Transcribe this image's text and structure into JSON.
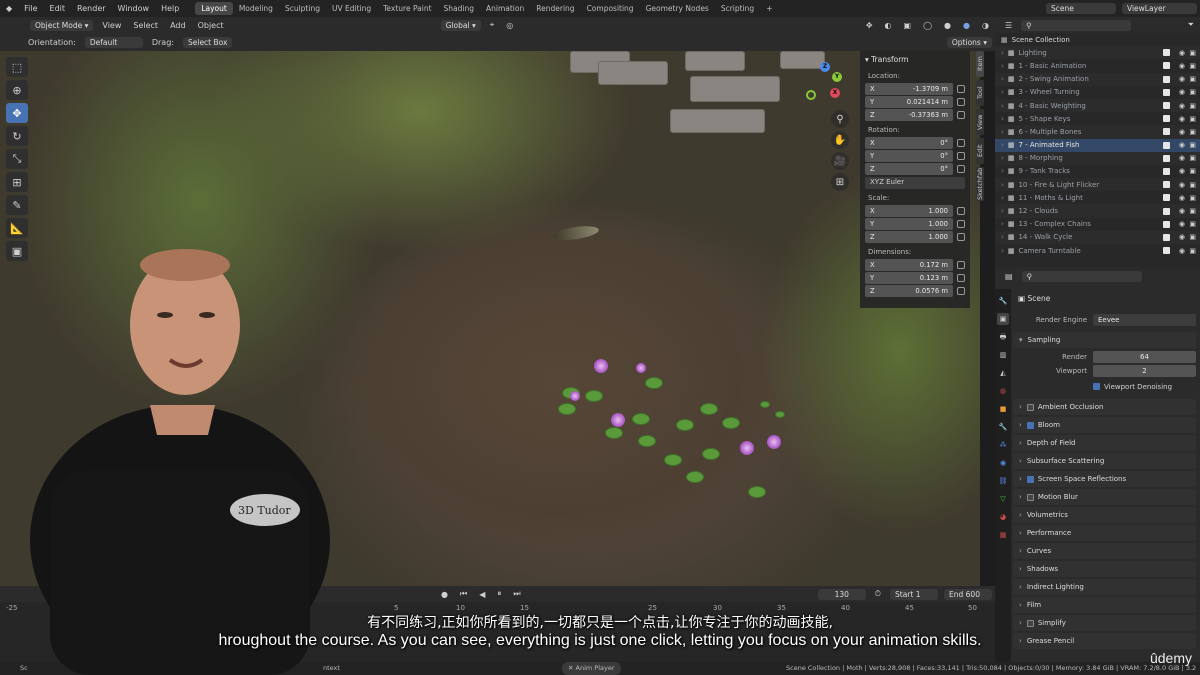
{
  "topbar": {
    "menus": [
      "File",
      "Edit",
      "Render",
      "Window",
      "Help"
    ],
    "workspaces": [
      "Layout",
      "Modeling",
      "Sculpting",
      "UV Editing",
      "Texture Paint",
      "Shading",
      "Animation",
      "Rendering",
      "Compositing",
      "Geometry Nodes",
      "Scripting"
    ],
    "active_workspace": "Layout",
    "add_tab": "+",
    "scene": "Scene",
    "view_layer": "ViewLayer"
  },
  "viewport_header": {
    "mode": "Object Mode",
    "menus": [
      "View",
      "Select",
      "Add",
      "Object"
    ],
    "transform_orientation": "Global",
    "orientation_label": "Orientation:",
    "orientation_value": "Default",
    "drag_label": "Drag:",
    "drag_value": "Select Box",
    "options": "Options"
  },
  "n_panel": {
    "title": "Transform",
    "location_label": "Location:",
    "location": [
      {
        "axis": "X",
        "value": "-1.3709 m"
      },
      {
        "axis": "Y",
        "value": "0.021414 m"
      },
      {
        "axis": "Z",
        "value": "-0.37363 m"
      }
    ],
    "rotation_label": "Rotation:",
    "rotation": [
      {
        "axis": "X",
        "value": "0°"
      },
      {
        "axis": "Y",
        "value": "0°"
      },
      {
        "axis": "Z",
        "value": "0°"
      }
    ],
    "rotation_mode": "XYZ Euler",
    "scale_label": "Scale:",
    "scale": [
      {
        "axis": "X",
        "value": "1.000"
      },
      {
        "axis": "Y",
        "value": "1.000"
      },
      {
        "axis": "Z",
        "value": "1.000"
      }
    ],
    "dimensions_label": "Dimensions:",
    "dimensions": [
      {
        "axis": "X",
        "value": "0.172 m"
      },
      {
        "axis": "Y",
        "value": "0.123 m"
      },
      {
        "axis": "Z",
        "value": "0.0576 m"
      }
    ],
    "side_tabs": [
      "Item",
      "Tool",
      "View",
      "Edit",
      "Sketchfab"
    ]
  },
  "outliner": {
    "root": "Scene Collection",
    "items": [
      "Lighting",
      "1 - Basic Animation",
      "2 - Swing Animation",
      "3 - Wheel Turning",
      "4 - Basic Weighting",
      "5 - Shape Keys",
      "6 - Multiple Bones",
      "7 - Animated Fish",
      "8 - Morphing",
      "9 - Tank Tracks",
      "10 - Fire & Light Flicker",
      "11 - Moths & Light",
      "12 - Clouds",
      "13 - Complex Chains",
      "14 - Walk Cycle",
      "Camera Turntable"
    ],
    "highlighted": "7 - Animated Fish"
  },
  "properties": {
    "context": "Scene",
    "render_engine_label": "Render Engine",
    "render_engine": "Eevee",
    "sampling": "Sampling",
    "render_label": "Render",
    "render_value": "64",
    "viewport_label": "Viewport",
    "viewport_value": "2",
    "viewport_denoising": "Viewport Denoising",
    "sections": [
      {
        "label": "Ambient Occlusion",
        "checkbox": true,
        "checked": false
      },
      {
        "label": "Bloom",
        "checkbox": true,
        "checked": true
      },
      {
        "label": "Depth of Field",
        "checkbox": false,
        "checked": false
      },
      {
        "label": "Subsurface Scattering",
        "checkbox": false,
        "checked": false
      },
      {
        "label": "Screen Space Reflections",
        "checkbox": true,
        "checked": true
      },
      {
        "label": "Motion Blur",
        "checkbox": true,
        "checked": false
      },
      {
        "label": "Volumetrics",
        "checkbox": false,
        "checked": false
      },
      {
        "label": "Performance",
        "checkbox": false,
        "checked": false
      },
      {
        "label": "Curves",
        "checkbox": false,
        "checked": false
      },
      {
        "label": "Shadows",
        "checkbox": false,
        "checked": false
      },
      {
        "label": "Indirect Lighting",
        "checkbox": false,
        "checked": false
      },
      {
        "label": "Film",
        "checkbox": false,
        "checked": false
      },
      {
        "label": "Simplify",
        "checkbox": true,
        "checked": false
      },
      {
        "label": "Grease Pencil",
        "checkbox": false,
        "checked": false
      }
    ]
  },
  "timeline": {
    "current_frame": "130",
    "start_label": "Start",
    "start": "1",
    "end_label": "End",
    "end": "600",
    "ruler_ticks": [
      "-25",
      "5",
      "10",
      "15",
      "25",
      "30",
      "35",
      "40",
      "45",
      "50"
    ]
  },
  "statusbar": {
    "left": "Sc",
    "left2": "ntext",
    "mode_chip": "Anim Player",
    "stats": "Scene Collection | Moth | Verts:28,908 | Faces:33,141 | Tris:50,084 | Objects:0/30 | Memory: 3.84 GiB | VRAM: 7.2/8.0 GiB | 3.2"
  },
  "overlay": {
    "subtitle_cn": "有不同练习,正如你所看到的,一切都只是一个点击,让你专注于你的动画技能,",
    "subtitle_en": "hroughout the course. As you can see, everything is just one click, letting you focus on your animation skills.",
    "shirt_text": "3D Tudor",
    "watermark": "ûdemy"
  },
  "colors": {
    "accent": "#4772b3",
    "highlight": "#e8e8e8"
  }
}
